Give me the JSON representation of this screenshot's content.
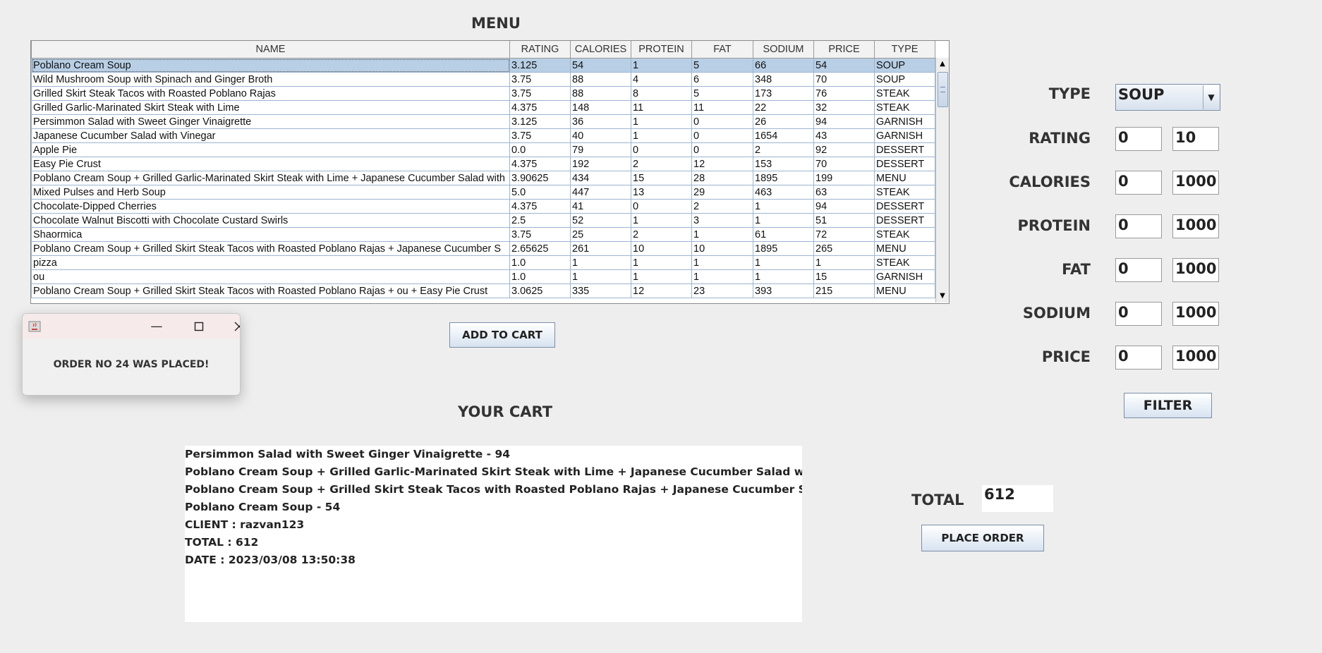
{
  "menu": {
    "title": "MENU",
    "columns": [
      "NAME",
      "RATING",
      "CALORIES",
      "PROTEIN",
      "FAT",
      "SODIUM",
      "PRICE",
      "TYPE"
    ],
    "rows": [
      [
        "Poblano Cream Soup",
        "3.125",
        "54",
        "1",
        "5",
        "66",
        "54",
        "SOUP"
      ],
      [
        "Wild Mushroom Soup with Spinach and Ginger Broth",
        "3.75",
        "88",
        "4",
        "6",
        "348",
        "70",
        "SOUP"
      ],
      [
        "Grilled Skirt Steak Tacos with Roasted Poblano Rajas",
        "3.75",
        "88",
        "8",
        "5",
        "173",
        "76",
        "STEAK"
      ],
      [
        "Grilled Garlic-Marinated Skirt Steak with Lime",
        "4.375",
        "148",
        "11",
        "11",
        "22",
        "32",
        "STEAK"
      ],
      [
        "Persimmon Salad with Sweet Ginger Vinaigrette",
        "3.125",
        "36",
        "1",
        "0",
        "26",
        "94",
        "GARNISH"
      ],
      [
        "Japanese Cucumber Salad with Vinegar",
        "3.75",
        "40",
        "1",
        "0",
        "1654",
        "43",
        "GARNISH"
      ],
      [
        "Apple Pie",
        "0.0",
        "79",
        "0",
        "0",
        "2",
        "92",
        "DESSERT"
      ],
      [
        "Easy Pie Crust",
        "4.375",
        "192",
        "2",
        "12",
        "153",
        "70",
        "DESSERT"
      ],
      [
        "Poblano Cream Soup  + Grilled Garlic-Marinated Skirt Steak with Lime  + Japanese Cucumber Salad with",
        "3.90625",
        "434",
        "15",
        "28",
        "1895",
        "199",
        "MENU"
      ],
      [
        "Mixed Pulses and Herb Soup",
        "5.0",
        "447",
        "13",
        "29",
        "463",
        "63",
        "STEAK"
      ],
      [
        "Chocolate-Dipped Cherries",
        "4.375",
        "41",
        "0",
        "2",
        "1",
        "94",
        "DESSERT"
      ],
      [
        "Chocolate Walnut Biscotti with Chocolate Custard Swirls",
        "2.5",
        "52",
        "1",
        "3",
        "1",
        "51",
        "DESSERT"
      ],
      [
        "Shaormica",
        "3.75",
        "25",
        "2",
        "1",
        "61",
        "72",
        "STEAK"
      ],
      [
        "Poblano Cream Soup  + Grilled Skirt Steak Tacos with Roasted Poblano Rajas  + Japanese Cucumber S",
        "2.65625",
        "261",
        "10",
        "10",
        "1895",
        "265",
        "MENU"
      ],
      [
        "pizza",
        "1.0",
        "1",
        "1",
        "1",
        "1",
        "1",
        "STEAK"
      ],
      [
        "ou",
        "1.0",
        "1",
        "1",
        "1",
        "1",
        "15",
        "GARNISH"
      ],
      [
        "Poblano Cream Soup  + Grilled Skirt Steak Tacos with Roasted Poblano Rajas  + ou + Easy Pie Crust",
        "3.0625",
        "335",
        "12",
        "23",
        "393",
        "215",
        "MENU"
      ]
    ],
    "selected_row": 0,
    "add_to_cart_label": "ADD TO CART"
  },
  "filter": {
    "type_label": "TYPE",
    "type_value": "SOUP",
    "fields": [
      {
        "label": "RATING",
        "min": "0",
        "max": "10"
      },
      {
        "label": "CALORIES",
        "min": "0",
        "max": "1000"
      },
      {
        "label": "PROTEIN",
        "min": "0",
        "max": "1000"
      },
      {
        "label": "FAT",
        "min": "0",
        "max": "1000"
      },
      {
        "label": "SODIUM",
        "min": "0",
        "max": "1000"
      },
      {
        "label": "PRICE",
        "min": "0",
        "max": "1000"
      }
    ],
    "filter_button_label": "FILTER"
  },
  "cart": {
    "title": "YOUR CART",
    "lines": [
      "Persimmon Salad with Sweet Ginger Vinaigrette  -  94",
      "Poblano Cream Soup  + Grilled Garlic-Marinated Skirt Steak with Lime  + Japanese Cucumber Salad with Vinegar",
      "Poblano Cream Soup  + Grilled Skirt Steak Tacos with Roasted Poblano Rajas  + Japanese Cucumber Salad with V",
      "Poblano Cream Soup  -  54",
      "CLIENT : razvan123",
      "TOTAL : 612",
      "DATE : 2023/03/08 13:50:38"
    ],
    "total_label": "TOTAL",
    "total_value": "612",
    "place_order_label": "PLACE ORDER"
  },
  "popup": {
    "message": "ORDER NO 24 WAS PLACED!",
    "icons": [
      "java-app-icon",
      "minimize-icon",
      "maximize-icon",
      "close-icon"
    ]
  },
  "colors": {
    "background": "#eeeeee",
    "selection": "#b8cfe5",
    "grid": "#9db4d1"
  }
}
